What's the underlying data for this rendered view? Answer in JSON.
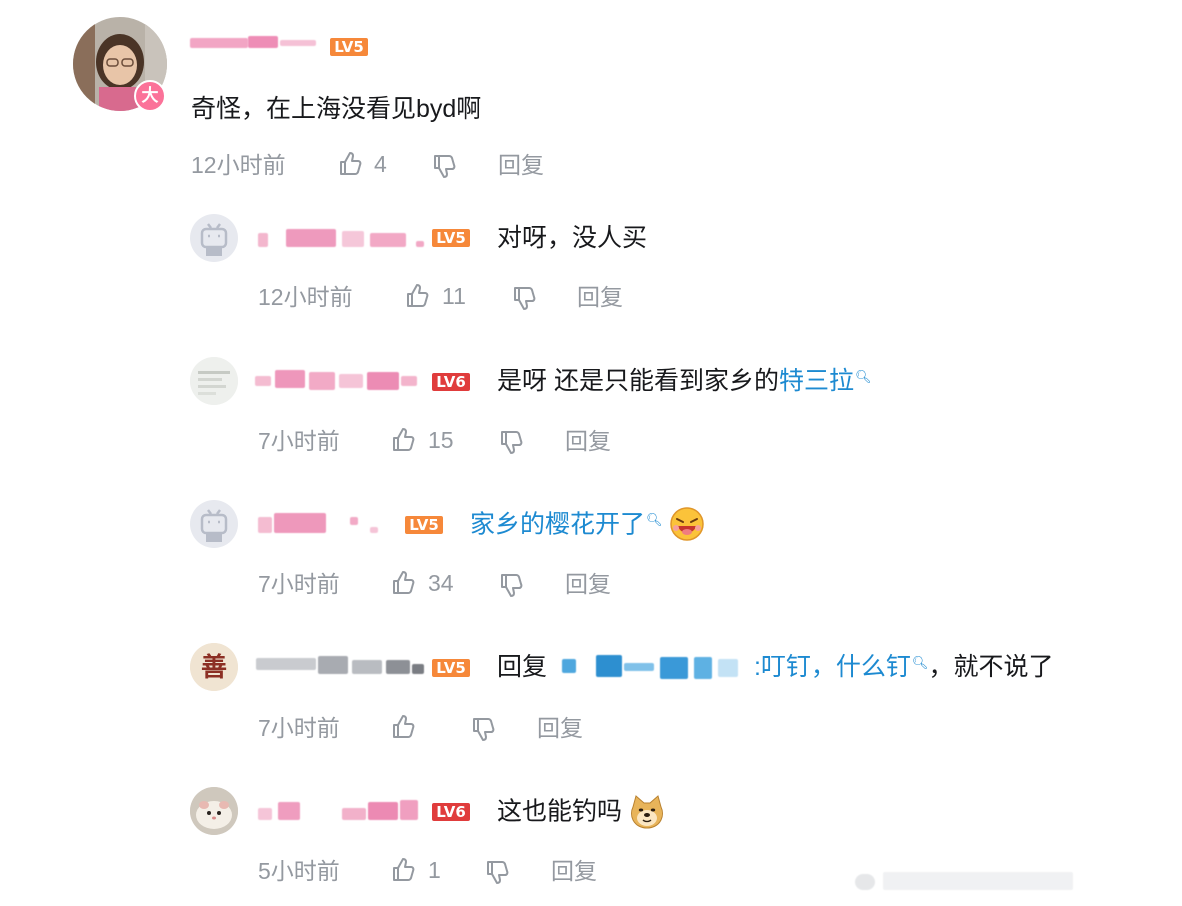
{
  "comments": [
    {
      "level": "LV5",
      "badge": "大",
      "content": "奇怪，在上海没看见byd啊",
      "time": "12小时前",
      "likes": "4",
      "reply_label": "回复"
    },
    {
      "level": "LV5",
      "content": "对呀，没人买",
      "time": "12小时前",
      "likes": "11",
      "reply_label": "回复"
    },
    {
      "level": "LV6",
      "content_plain": "是呀 还是只能看到家乡的",
      "content_link": "特三拉",
      "time": "7小时前",
      "likes": "15",
      "reply_label": "回复"
    },
    {
      "level": "LV5",
      "content_link": "家乡的樱花开了",
      "emoji": "laughing-emoji",
      "time": "7小时前",
      "likes": "34",
      "reply_label": "回复"
    },
    {
      "level": "LV5",
      "reply_prefix": "回复",
      "content_link": ":叮钉，什么钉",
      "content_tail": "，就不说了",
      "time": "7小时前",
      "likes": "",
      "reply_label": "回复"
    },
    {
      "level": "LV6",
      "content": "这也能钓吗",
      "emoji": "doge-emoji",
      "time": "5小时前",
      "likes": "1",
      "reply_label": "回复"
    }
  ],
  "colors": {
    "lv5": "#f6883a",
    "lv6": "#e03c3c",
    "link": "#1d8ad1",
    "meta": "#9499a0"
  }
}
